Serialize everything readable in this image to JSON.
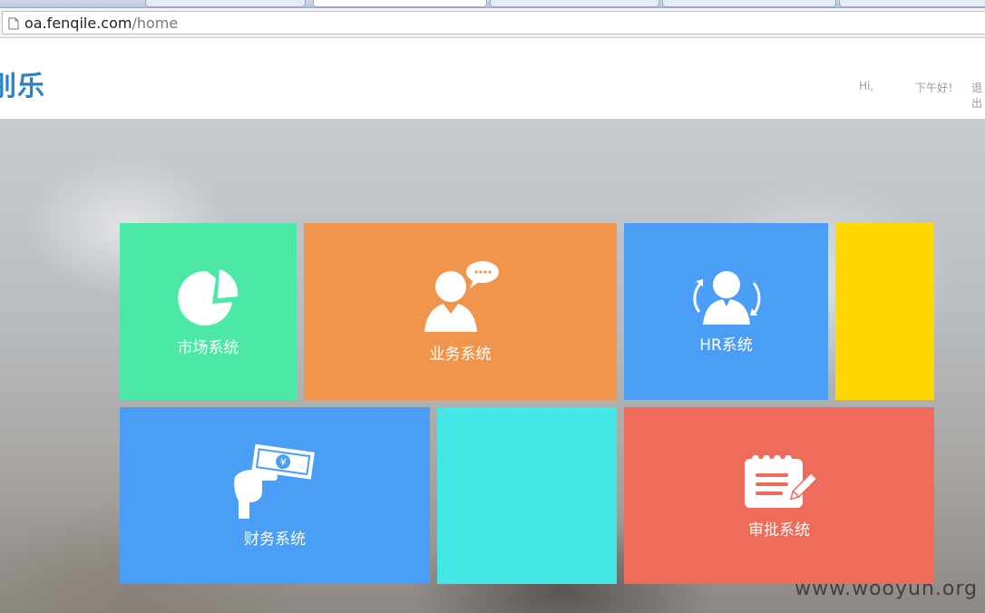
{
  "browser": {
    "url_host": "oa.fenqile.com",
    "url_path": "/home"
  },
  "header": {
    "logo_text": "乐",
    "logo_partial": "刖",
    "greeting_hi": "Hi,",
    "greeting_time": "下午好！",
    "logout_partial": "退出"
  },
  "tiles": [
    {
      "label": "市场系统",
      "color": "#4be8a6",
      "icon": "pie-chart-icon"
    },
    {
      "label": "业务系统",
      "color": "#f0954b",
      "icon": "person-chat-icon"
    },
    {
      "label": "HR系统",
      "color": "#4a9ef5",
      "icon": "person-rotate-icon"
    },
    {
      "label": "",
      "color": "#ffd800",
      "icon": ""
    },
    {
      "label": "财务系统",
      "color": "#4a9ef5",
      "icon": "hand-money-icon"
    },
    {
      "label": "",
      "color": "#44e6e6",
      "icon": ""
    },
    {
      "label": "审批系统",
      "color": "#ef6b5a",
      "icon": "notepad-pen-icon"
    }
  ],
  "watermark": "www.wooyun.org"
}
